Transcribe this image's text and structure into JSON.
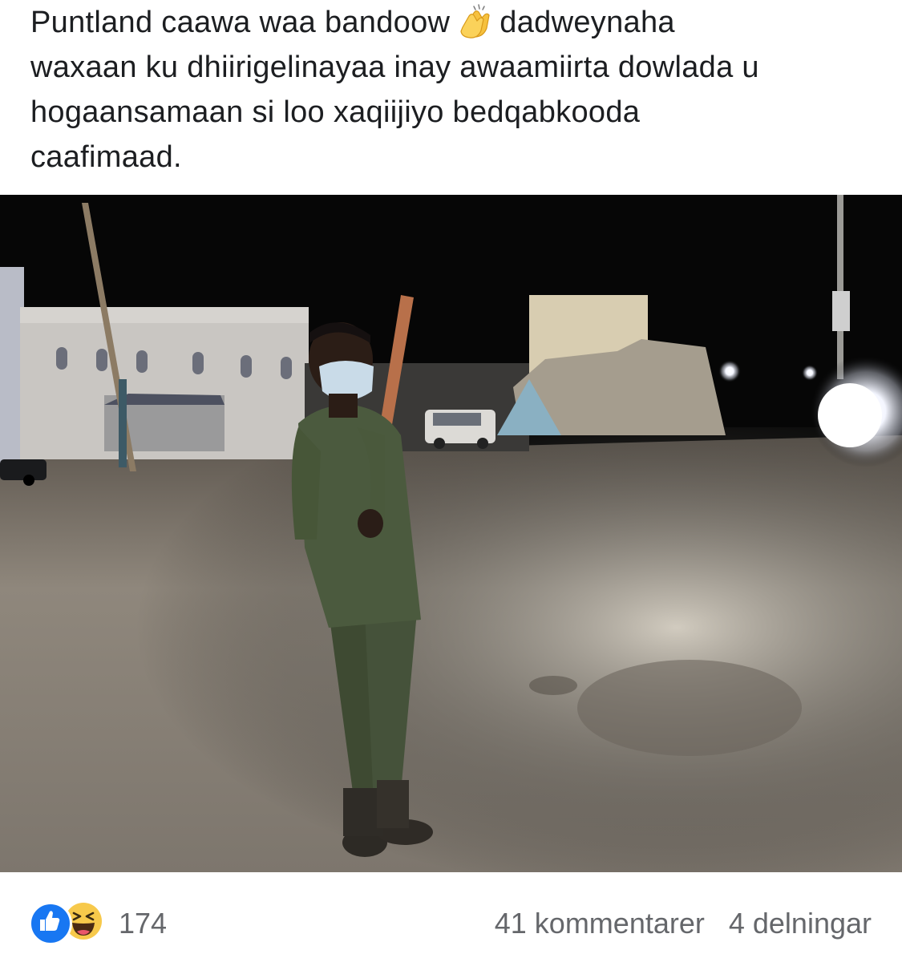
{
  "post": {
    "text_line1_a": "Puntland caawa waa bandoow",
    "text_line1_b": "dadweynaha",
    "text_line2": "waxaan ku dhiirigelinayaa inay awaamiirta dowlada u",
    "text_line3": "hogaansamaan si loo xaqiijiyo bedqabkooda",
    "text_line4": "caafimaad.",
    "emoji": "clapping-hands-icon"
  },
  "footer": {
    "reaction_icons": [
      "like-icon",
      "haha-icon"
    ],
    "reaction_count": "174",
    "comments": "41 kommentarer",
    "shares": "4 delningar"
  },
  "colors": {
    "like_blue": "#1877f2",
    "haha_yellow": "#f7c94b",
    "secondary_text": "#65676b",
    "primary_text": "#1c1e21"
  }
}
